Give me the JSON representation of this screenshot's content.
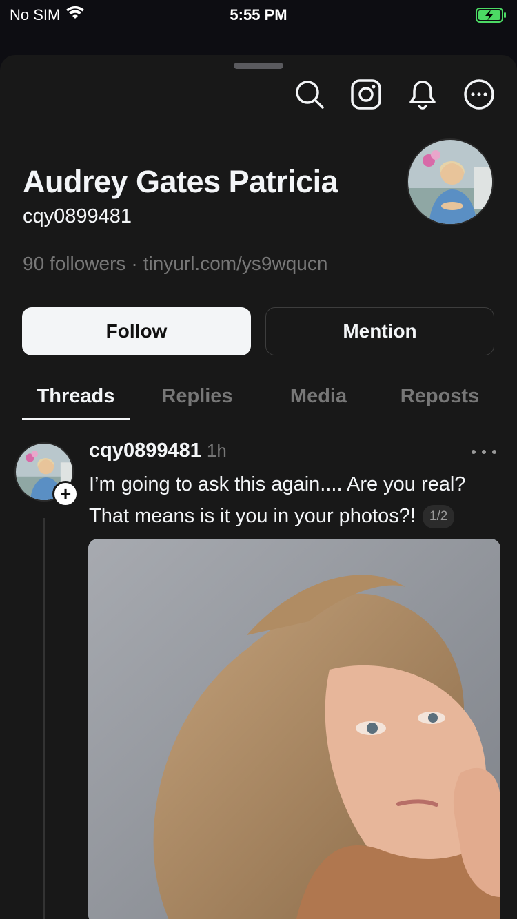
{
  "status_bar": {
    "carrier": "No SIM",
    "time": "5:55 PM"
  },
  "profile": {
    "name": "Audrey Gates Patricia",
    "handle": "cqy0899481",
    "followers": "90 followers",
    "separator": "·",
    "link": "tinyurl.com/ys9wqucn"
  },
  "actions": {
    "follow_label": "Follow",
    "mention_label": "Mention"
  },
  "tabs": [
    {
      "label": "Threads",
      "active": true
    },
    {
      "label": "Replies",
      "active": false
    },
    {
      "label": "Media",
      "active": false
    },
    {
      "label": "Reposts",
      "active": false
    }
  ],
  "post": {
    "username": "cqy0899481",
    "time": "1h",
    "text": "I’m going to ask this again.... Are you real? That means is it you in your photos?!",
    "page_indicator": "1/2"
  },
  "colors": {
    "sheet": "#181818",
    "text": "#f3f5f7",
    "muted": "#777777",
    "battery": "#4cd964"
  }
}
